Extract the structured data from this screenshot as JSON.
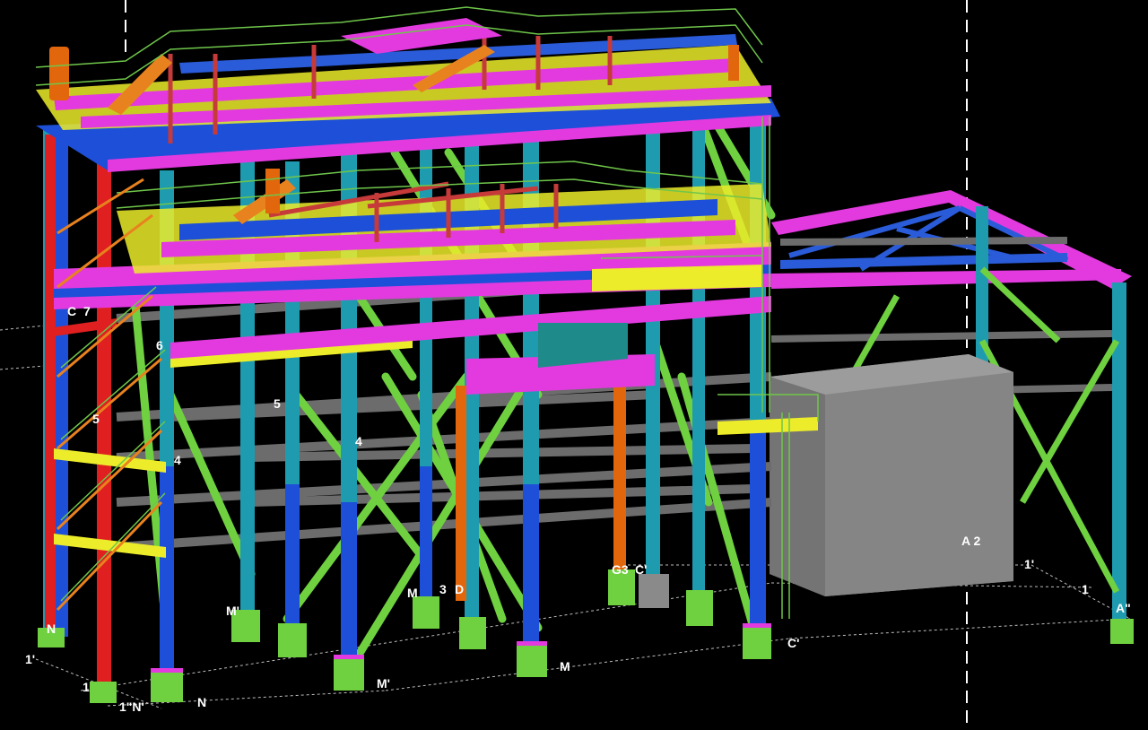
{
  "viewport": {
    "background": "#000000"
  },
  "colors": {
    "column_cyan": "#1f9bb0",
    "column_blue": "#1d4fd8",
    "column_red": "#e02020",
    "column_orange": "#e2660c",
    "beam_magenta": "#e23adf",
    "beam_blue": "#2a5bd8",
    "beam_grey": "#6c6c6c",
    "brace_green": "#6fd140",
    "grating_yellow": "#ecec2a",
    "handrail_green": "#6fc64a",
    "stair_orange": "#e8821e",
    "equipment_grey": "#8a8a8a",
    "grid_line": "#d0d0d0",
    "label": "#ffffff"
  },
  "grid_labels": {
    "left_c7": "C",
    "left_7": "7",
    "left_6": "6",
    "left_5a": "5",
    "left_5b": "5",
    "left_4a": "4",
    "left_4b": "4",
    "m_prime_left": "M'",
    "m_mid": "M",
    "three": "3",
    "d": "D",
    "g3": "G3",
    "c_prime_mid": "C'",
    "a2": "A 2",
    "one_prime_right": "1'",
    "one_right": "1",
    "a_double_prime": "A\"",
    "c_prime_bottom": "C'",
    "m_bottom": "M",
    "m_prime_bottom": "M'",
    "n_bottom": "N",
    "n_left": "N",
    "one_prime_left": "1'",
    "one_left": "1",
    "one_double_n": "1\"N'"
  }
}
